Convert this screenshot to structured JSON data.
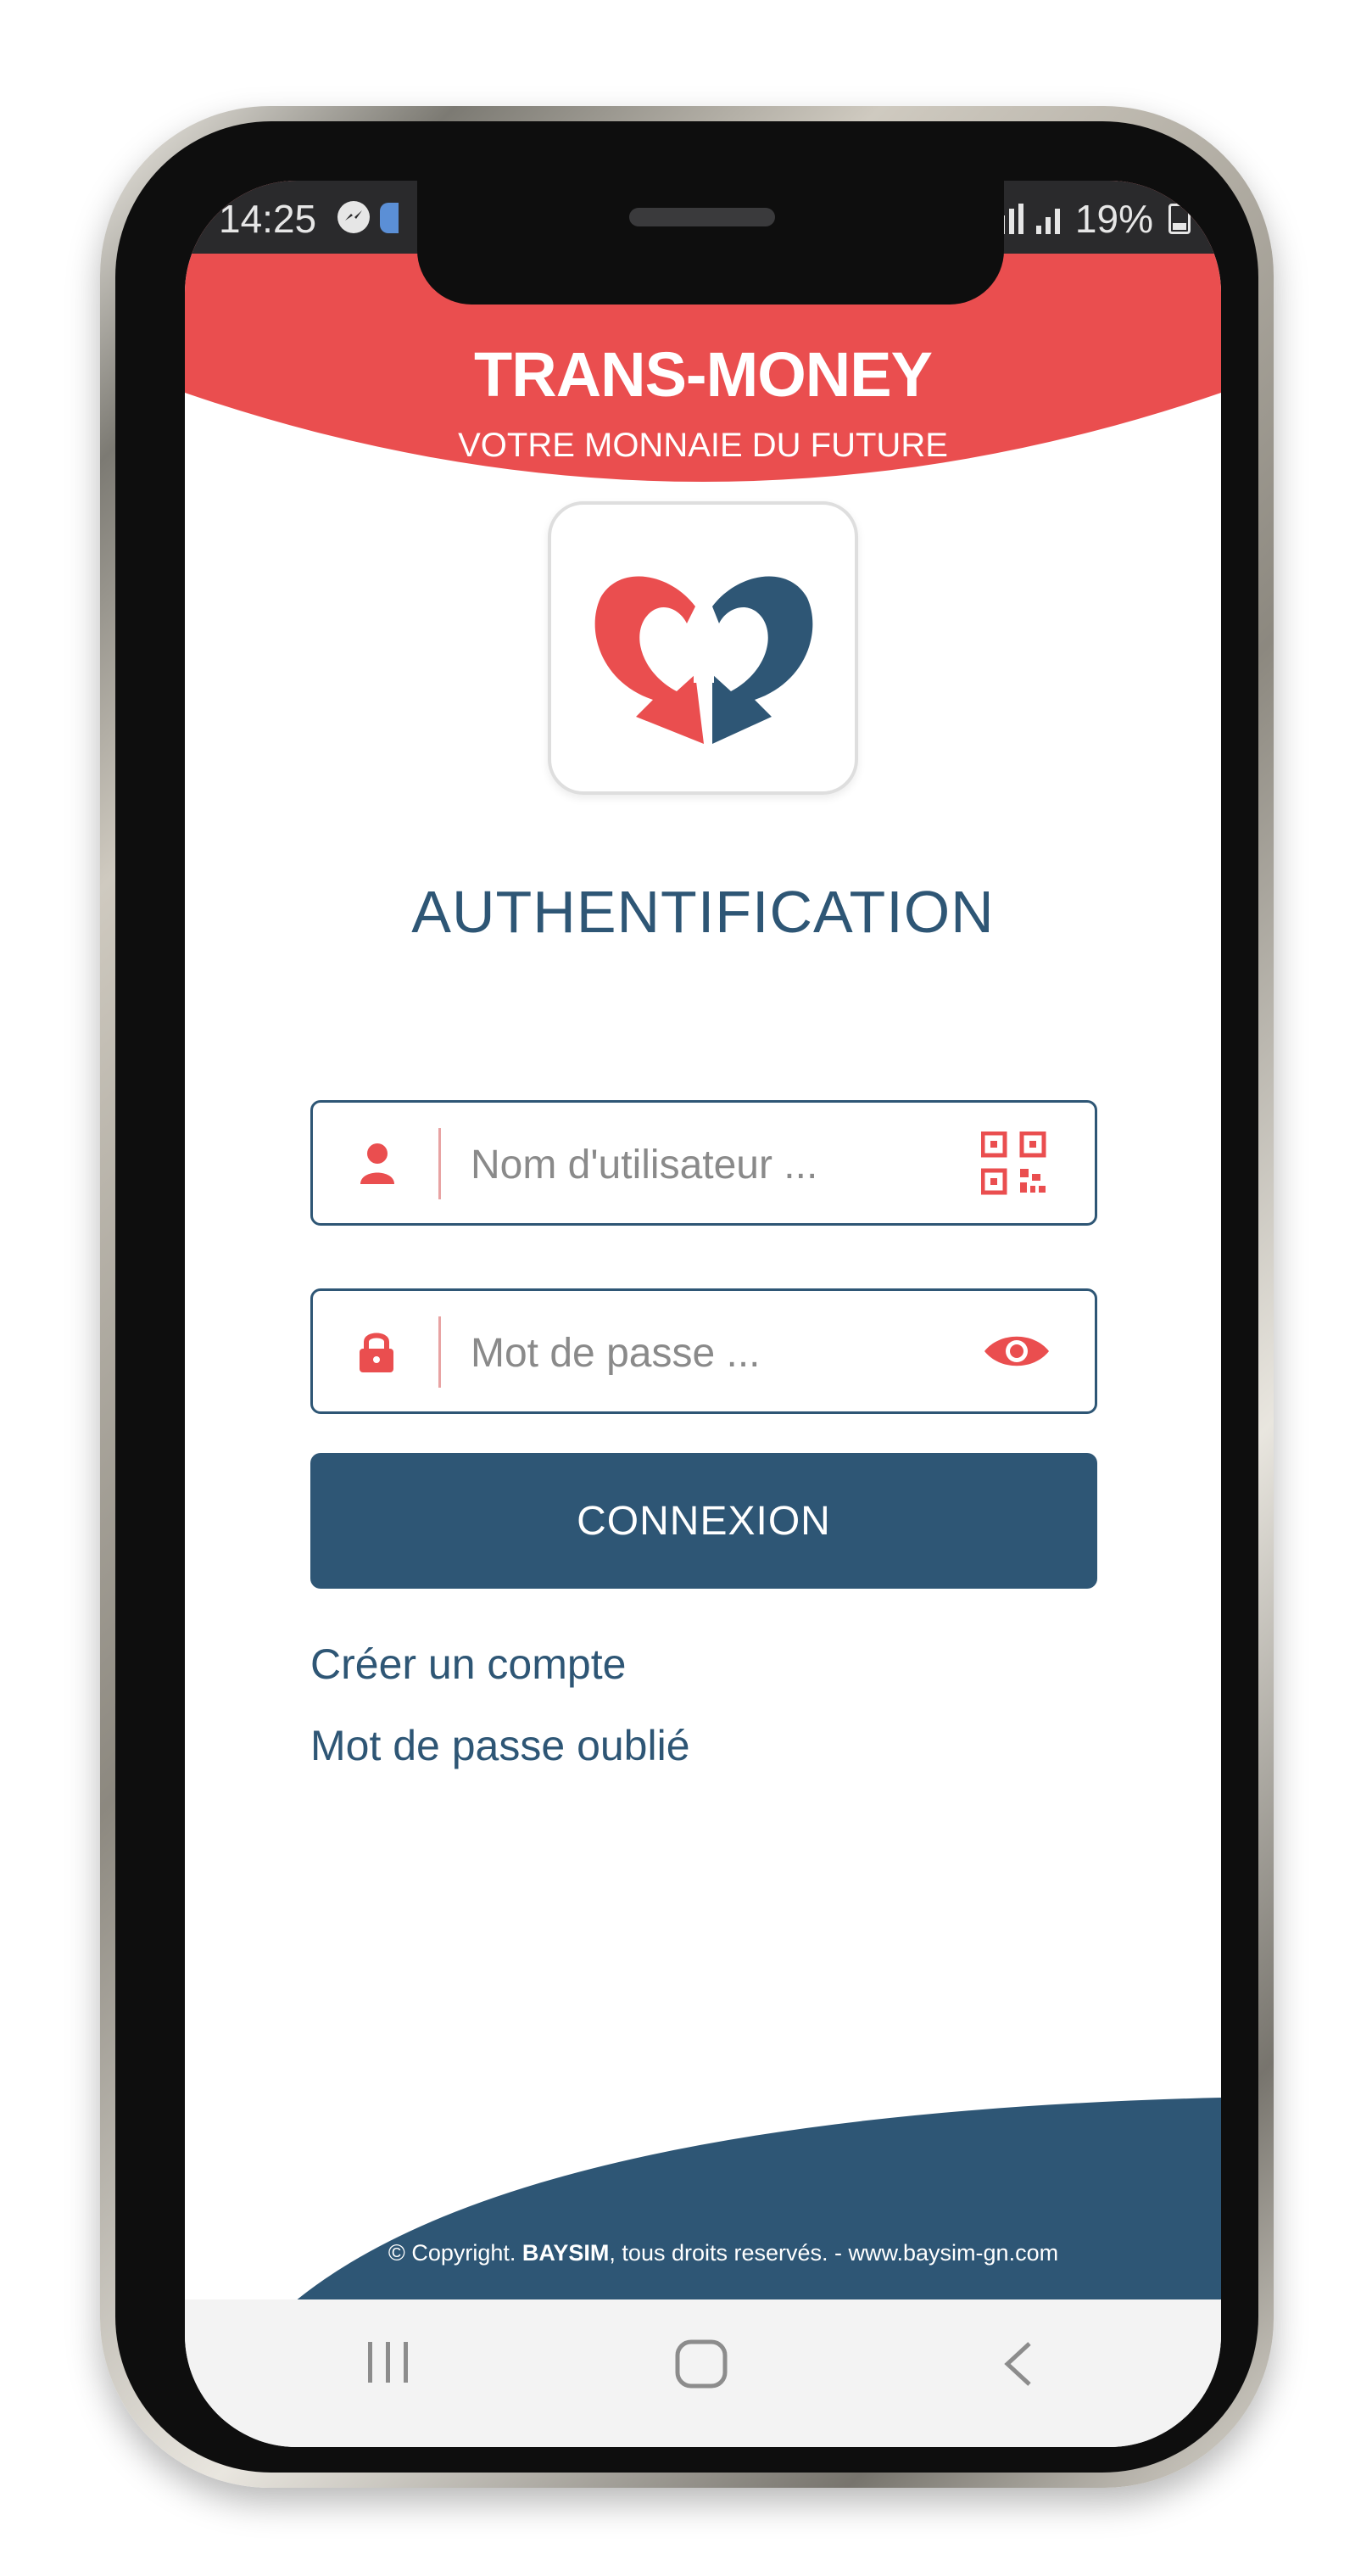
{
  "colors": {
    "brand_red": "#ea4e4f",
    "brand_blue": "#2e5675",
    "white": "#ffffff",
    "nav_bg": "#f3f3f3"
  },
  "status_bar": {
    "time": "14:25",
    "battery": "19%",
    "icons": [
      "messenger-icon",
      "signal-icon",
      "battery-icon"
    ]
  },
  "header": {
    "title": "TRANS-MONEY",
    "subtitle": "VOTRE MONNAIE DU FUTURE"
  },
  "login": {
    "heading": "AUTHENTIFICATION",
    "username": {
      "placeholder": "Nom d'utilisateur ...",
      "value": "",
      "lead_icon": "user-icon",
      "trail_icon": "qr-code-icon"
    },
    "password": {
      "placeholder": "Mot de passe ...",
      "value": "",
      "lead_icon": "lock-icon",
      "trail_icon": "eye-icon"
    },
    "submit_label": "CONNEXION",
    "create_account_label": "Créer un compte",
    "forgot_password_label": "Mot de passe oublié"
  },
  "footer": {
    "copyright_prefix": "© Copyright.",
    "copyright_brand": "BAYSIM",
    "copyright_suffix": ", tous droits reservés. - www.baysim-gn.com"
  },
  "navigation": {
    "icons": [
      "recents-icon",
      "home-icon",
      "back-icon"
    ]
  }
}
